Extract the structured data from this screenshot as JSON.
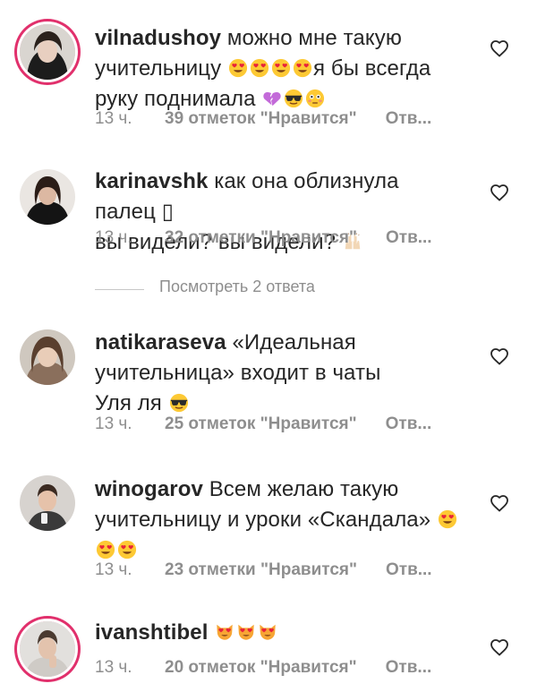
{
  "comments": [
    {
      "username": "vilnadushoy",
      "text_line1": "можно мне такую",
      "text_line2": "учительницу",
      "text_line2b": "я бы всегда",
      "text_line3": "руку поднимала",
      "time": "13 ч.",
      "likes": "39 отметок \"Нравится\"",
      "reply": "Отв...",
      "emojis": [
        "heart-eyes",
        "heart-eyes",
        "heart-eyes",
        "heart-eyes",
        "broken-heart",
        "sunglasses",
        "flushed"
      ]
    },
    {
      "username": "karinavshk",
      "text_line1": "как она облизнула палец ▯",
      "text_line2": "вы видели? вы видели?",
      "time": "13 ч.",
      "likes": "32 отметки \"Нравится\"",
      "reply": "Отв...",
      "emojis": [
        "raised-hands"
      ]
    },
    {
      "username": "natikaraseva",
      "text_line1": "«Идеальная",
      "text_line2": "учительница» входит в чаты",
      "text_line3": "Уля ля",
      "time": "13 ч.",
      "likes": "25 отметок \"Нравится\"",
      "reply": "Отв...",
      "emojis": [
        "sunglasses"
      ]
    },
    {
      "username": "winogarov",
      "text_line1": "Всем желаю такую",
      "text_line2": "учительницу и уроки «Скандала»",
      "time": "13 ч.",
      "likes": "23 отметки \"Нравится\"",
      "reply": "Отв...",
      "emojis": [
        "heart-eyes",
        "heart-eyes",
        "heart-eyes"
      ]
    },
    {
      "username": "ivanshtibel",
      "text_line1": "",
      "time": "13 ч.",
      "likes": "20 отметок \"Нравится\"",
      "reply": "Отв...",
      "emojis": [
        "heart-eyes-cat",
        "heart-eyes-cat",
        "heart-eyes-cat"
      ]
    }
  ],
  "view_replies": "Посмотреть 2 ответа",
  "colors": {
    "text": "#262626",
    "meta": "#8e8e8e",
    "story_ring": "#e1306c",
    "emoji_yellow": "#fdc934",
    "heart_red": "#e8233a"
  }
}
